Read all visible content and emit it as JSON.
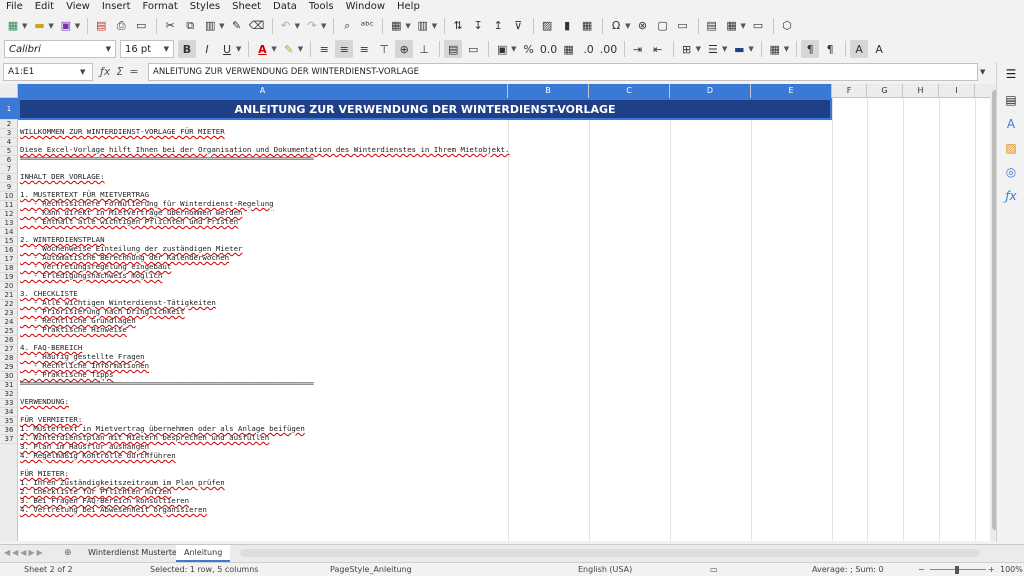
{
  "menu": [
    "File",
    "Edit",
    "View",
    "Insert",
    "Format",
    "Styles",
    "Sheet",
    "Data",
    "Tools",
    "Window",
    "Help"
  ],
  "font": {
    "name": "Calibri",
    "size": "16 pt"
  },
  "namebox": "A1:E1",
  "formula": "ANLEITUNG ZUR VERWENDUNG DER WINTERDIENST-VORLAGE",
  "columns": [
    "A",
    "B",
    "C",
    "D",
    "E",
    "F",
    "G",
    "H",
    "I"
  ],
  "rows": [
    "1",
    "2",
    "3",
    "4",
    "5",
    "6",
    "7",
    "8",
    "9",
    "10",
    "11",
    "12",
    "13",
    "14",
    "15",
    "16",
    "17",
    "18",
    "19",
    "20",
    "21",
    "22",
    "23",
    "24",
    "25",
    "26",
    "27",
    "28",
    "29",
    "30",
    "31",
    "32",
    "33",
    "34",
    "35",
    "36",
    "37"
  ],
  "title": "ANLEITUNG ZUR VERWENDUNG DER WINTERDIENST-VORLAGE",
  "lines": {
    "r3": "WILLKOMMEN ZUR WINTERDIENST-VORLAGE FÜR MIETER",
    "r5": "Diese Excel-Vorlage hilft Ihnen bei der Organisation und Dokumentation des Winterdienstes in Ihrem Mietobjekt.",
    "r6": "══════════════════════════════════════════════════════════════════",
    "r8": "INHALT DER VORLAGE:",
    "r10": "1. MUSTERTEXT FÜR MIETVERTRAG",
    "r11": "   - Rechtssichere Formulierung für Winterdienst-Regelung",
    "r12": "   - Kann direkt in Mietverträge übernommen werden",
    "r13": "   - Enthält alle wichtigen Pflichten und Fristen",
    "r15": "2. WINTERDIENSTPLAN",
    "r16": "   - Wochenweise Einteilung der zuständigen Mieter",
    "r17": "   - Automatische Berechnung der Kalenderwochen",
    "r18": "   - Vertretungsregelung eingebaut",
    "r19": "   - Erledigungsnachweis möglich",
    "r21": "3. CHECKLISTE",
    "r22": "   - Alle wichtigen Winterdienst-Tätigkeiten",
    "r23": "   - Priorisierung nach Dringlichkeit",
    "r24": "   - Rechtliche Grundlagen",
    "r25": "   - Praktische Hinweise",
    "r27": "4. FAQ-BEREICH",
    "r28": "   - Häufig gestellte Fragen",
    "r29": "   - Rechtliche Informationen",
    "r30": "   - Praktische Tipps",
    "r32": "══════════════════════════════════════════════════════════════════",
    "r34": "VERWENDUNG:",
    "r36": "FÜR VERMIETER:",
    "r37": "1. Mustertext in Mietvertrag übernehmen oder als Anlage beifügen",
    "r38": "2. Winterdienstplan mit Mietern besprechen und ausfüllen",
    "r39": "3. Plan im Hausflur aushängen",
    "r40": "4. Regelmäßig Kontrolle durchführen",
    "r42": "FÜR MIETER:",
    "r43": "1. Ihren Zuständigkeitszeitraum im Plan prüfen",
    "r44": "2. Checkliste für Pflichten nutzen",
    "r45": "3. Bei Fragen FAQ-Bereich konsultieren",
    "r46": "4. Vertretung bei Abwesenheit organisieren"
  },
  "tabs": [
    "Winterdienst Mustertext",
    "Anleitung"
  ],
  "status": {
    "sheet": "Sheet 2 of 2",
    "selection": "Selected: 1 row, 5 columns",
    "pagestyle": "PageStyle_Anleitung",
    "language": "English (USA)",
    "sum": "Average: ; Sum: 0",
    "zoom": "100%"
  }
}
